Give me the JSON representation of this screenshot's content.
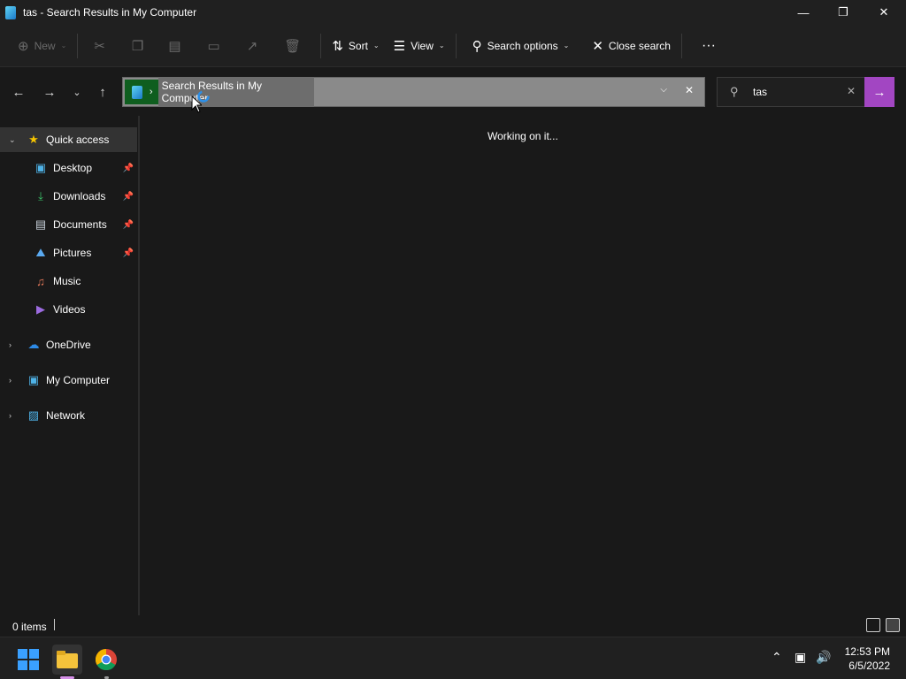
{
  "window": {
    "title": "tas - Search Results in My Computer"
  },
  "toolbar": {
    "new": "New",
    "sort": "Sort",
    "view": "View",
    "search_options": "Search options",
    "close_search": "Close search",
    "more": "···"
  },
  "address": {
    "path": "Search Results in My Computer"
  },
  "search": {
    "value": "tas"
  },
  "sidebar": {
    "quick_access": "Quick access",
    "items": [
      {
        "label": "Desktop"
      },
      {
        "label": "Downloads"
      },
      {
        "label": "Documents"
      },
      {
        "label": "Pictures"
      },
      {
        "label": "Music"
      },
      {
        "label": "Videos"
      }
    ],
    "onedrive": "OneDrive",
    "my_computer": "My Computer",
    "network": "Network"
  },
  "content": {
    "status": "Working on it..."
  },
  "statusbar": {
    "count": "0 items"
  },
  "clock": {
    "time": "12:53 PM",
    "date": "6/5/2022"
  },
  "colors": {
    "accent": "#a246c2",
    "selection": "#0f5e1f",
    "background": "#191919"
  }
}
